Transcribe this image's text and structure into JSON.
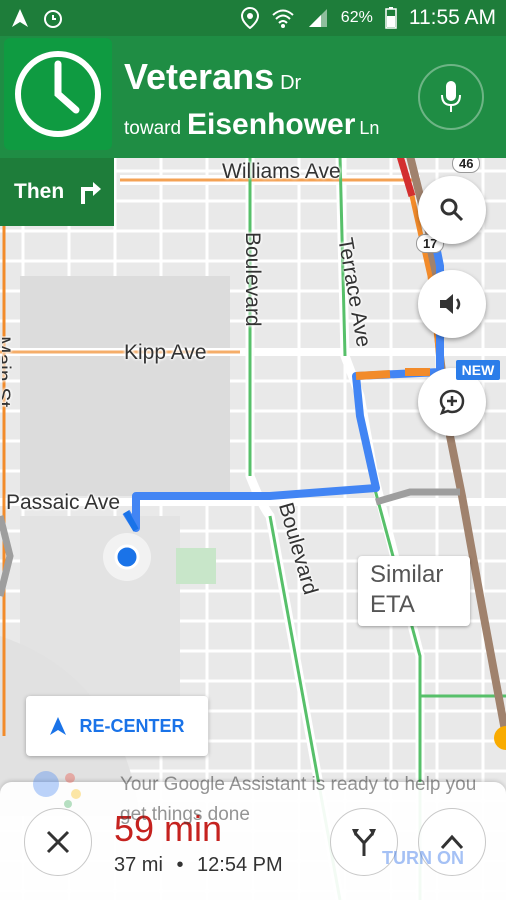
{
  "status_bar": {
    "left_icons": [
      "navigation-icon",
      "alarm-clock-icon"
    ],
    "right_icons": [
      "location-pin-icon",
      "wifi-icon",
      "signal-icon",
      "battery-icon"
    ],
    "battery": "62%",
    "time": "11:55 AM"
  },
  "navigation": {
    "current_street": "Veterans",
    "current_suffix": "Dr",
    "toward_label": "toward",
    "toward_street": "Eisenhower",
    "toward_suffix": "Ln",
    "then_label": "Then",
    "then_icon": "turn-right-icon",
    "maneuver_icon": "clock-icon",
    "colors": {
      "header": "#1f8d44",
      "tile": "#0f9b41",
      "status": "#1e7d3a"
    }
  },
  "map": {
    "streets": {
      "williams": "Williams Ave",
      "boulevard_top": "Boulevard",
      "terrace": "Terrace Ave",
      "kipp": "Kipp Ave",
      "passaic": "Passaic Ave",
      "boulevard_bottom": "Boulevard",
      "main": "Main St"
    },
    "route_badges": [
      "46",
      "17"
    ],
    "eta_bubble": [
      "Similar",
      "ETA"
    ],
    "new_badge": "NEW",
    "route_color": "#4285f4"
  },
  "controls": {
    "search_icon": "search-icon",
    "sound_icon": "sound-icon",
    "report_icon": "add-report-icon",
    "recenter_label": "RE-CENTER"
  },
  "assistant": {
    "message": "Your Google Assistant is ready to help you get things done",
    "action": "TURN ON"
  },
  "trip": {
    "duration": "59 min",
    "distance": "37 mi",
    "arrival": "12:54 PM",
    "separator": "•"
  }
}
